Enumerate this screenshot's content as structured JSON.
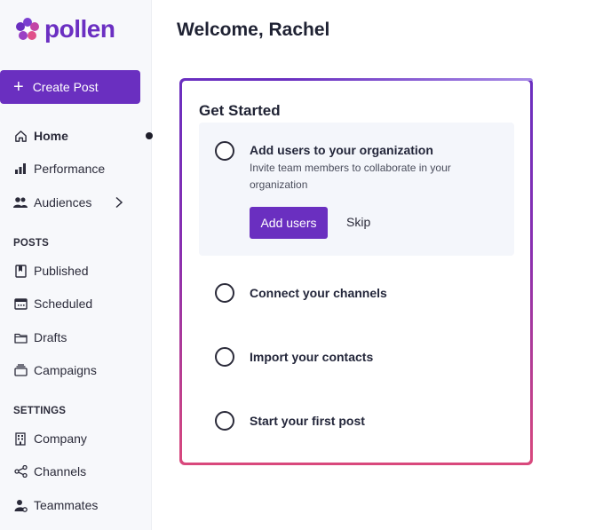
{
  "brand": {
    "name": "pollen",
    "color": "#6a2fc0"
  },
  "sidebar": {
    "create_label": "Create Post",
    "items": [
      {
        "label": "Home",
        "icon": "home-icon",
        "active": true
      },
      {
        "label": "Performance",
        "icon": "bar-chart-icon"
      },
      {
        "label": "Audiences",
        "icon": "people-icon"
      }
    ],
    "posts_label": "POSTS",
    "posts_items": [
      {
        "label": "Published",
        "icon": "bookmark-icon"
      },
      {
        "label": "Scheduled",
        "icon": "calendar-icon"
      },
      {
        "label": "Drafts",
        "icon": "folder-icon"
      },
      {
        "label": "Campaigns",
        "icon": "stack-icon"
      }
    ],
    "settings_label": "SETTINGS",
    "settings_items": [
      {
        "label": "Company",
        "icon": "building-icon"
      },
      {
        "label": "Channels",
        "icon": "share-icon"
      },
      {
        "label": "Teammates",
        "icon": "user-gear-icon"
      }
    ]
  },
  "main": {
    "welcome": "Welcome, Rachel",
    "card_title": "Get Started",
    "steps": [
      {
        "title": "Add users to your organization",
        "description": "Invite team members to collaborate in your organization",
        "primary_action": "Add users",
        "secondary_action": "Skip"
      },
      {
        "title": "Connect your channels"
      },
      {
        "title": "Import your contacts"
      },
      {
        "title": "Start your first post"
      }
    ]
  }
}
